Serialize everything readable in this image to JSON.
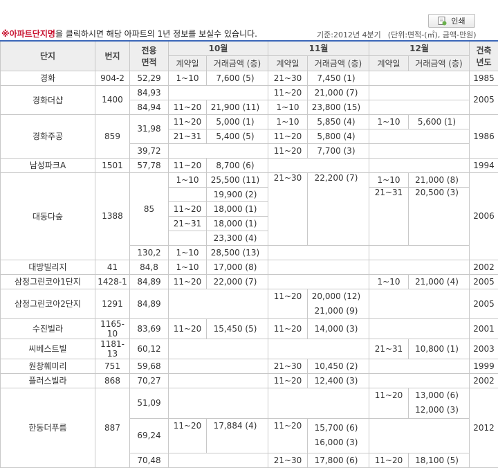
{
  "header": {
    "print_label": "인쇄",
    "notice_mark": "※",
    "notice_link": "아파트단지명",
    "notice_text": "을 클릭하시면 해당 아파트의 1년 정보를 보실수 있습니다.",
    "basis": "기준:2012년 4분기",
    "unit": "(단위:면적-(㎡), 금액-만원)"
  },
  "columns": {
    "complex": "단지",
    "lot": "번지",
    "area_l1": "전용",
    "area_l2": "면적",
    "m10": "10월",
    "m11": "11월",
    "m12": "12월",
    "year_l1": "건축",
    "year_l2": "년도",
    "contract_day": "계약일",
    "amount": "거래금액 (층)"
  },
  "rows": [
    {
      "name": "경화",
      "lot": "904-2",
      "area": "52,29",
      "d10": "1~10",
      "a10": "7,600 (5)",
      "d11": "21~30",
      "a11": "7,450 (1)",
      "year": "1985"
    },
    {
      "name": "경화더샵",
      "lot": "1400",
      "area1": "84,93",
      "area2": "84,94",
      "r1d11": "11~20",
      "r1a11": "21,000 (7)",
      "r2d10": "11~20",
      "r2a10": "21,900 (11)",
      "r2d11": "1~10",
      "r2a11": "23,800 (15)",
      "year": "2005"
    },
    {
      "name": "경화주공",
      "lot": "859",
      "area1": "31,98",
      "area2": "39,72",
      "r1d10": "11~20",
      "r1a10": "5,000 (1)",
      "r1d11": "1~10",
      "r1a11": "5,850 (4)",
      "r1d12": "1~10",
      "r1a12": "5,600 (1)",
      "r2d10": "21~31",
      "r2a10": "5,400 (5)",
      "r2d11": "11~20",
      "r2a11": "5,800 (4)",
      "r3d11": "11~20",
      "r3a11": "7,700 (3)",
      "year": "1986"
    },
    {
      "name": "남성파크A",
      "lot": "1501",
      "area": "57,78",
      "d10": "11~20",
      "a10": "8,700 (6)",
      "year": "1994"
    },
    {
      "name": "대동다숲",
      "lot": "1388",
      "area1": "85",
      "area2": "130,2",
      "g1d10": "1~10",
      "g1a10": [
        "25,500 (11)",
        "19,900 (2)"
      ],
      "g2d10": "11~20",
      "g2a10": "18,000 (1)",
      "g3d10": "21~31",
      "g3a10": [
        "18,000 (1)",
        "23,300 (4)"
      ],
      "d11": "21~30",
      "a11": "22,200 (7)",
      "g1d12": "1~10",
      "g1a12": "21,000 (8)",
      "g2d12": "21~31",
      "g2a12": "20,500 (3)",
      "r2d10": "1~10",
      "r2a10": "28,500 (13)",
      "year": "2006"
    },
    {
      "name": "대방빌리지",
      "lot": "41",
      "area": "84,8",
      "d10": "1~10",
      "a10": "17,000 (8)",
      "year": "2002"
    },
    {
      "name": "삼정그린코아1단지",
      "lot": "1428-1",
      "area": "84,89",
      "d10": "11~20",
      "a10": "22,000 (7)",
      "d12": "1~10",
      "a12": "21,000 (4)",
      "year": "2005"
    },
    {
      "name": "삼정그린코아2단지",
      "lot": "1291",
      "area": "84,89",
      "d11": "11~20",
      "a11": [
        "20,000 (12)",
        "21,000 (9)"
      ],
      "year": "2005"
    },
    {
      "name": "수진빌라",
      "lot": "1165-10",
      "area": "83,69",
      "d10": "11~20",
      "a10": "15,450 (5)",
      "d11": "11~20",
      "a11": "14,000 (3)",
      "year": "2001"
    },
    {
      "name": "씨베스트빌",
      "lot": "1181-13",
      "area": "60,12",
      "d12": "21~31",
      "a12": "10,800 (1)",
      "year": "2003"
    },
    {
      "name": "원창훼미리",
      "lot": "751",
      "area": "59,68",
      "d11": "21~30",
      "a11": "10,450 (2)",
      "year": "1999"
    },
    {
      "name": "플러스빌라",
      "lot": "868",
      "area": "70,27",
      "d11": "11~20",
      "a11": "12,400 (3)",
      "year": "2002"
    },
    {
      "name": "한동더푸름",
      "lot": "887",
      "area1": "51,09",
      "area2": "69,24",
      "area3": "70,48",
      "r1d12": "11~20",
      "r1a12": [
        "13,000 (6)",
        "12,000 (3)"
      ],
      "r2d10": "11~20",
      "r2a10": "17,884 (4)",
      "r2d11": "11~20",
      "r2a11": [
        "15,700 (6)",
        "16,000 (3)"
      ],
      "r3d11": "21~30",
      "r3a11": "17,800 (6)",
      "r3d12": "11~20",
      "r3a12": "18,100 (5)",
      "year": "2012"
    }
  ]
}
